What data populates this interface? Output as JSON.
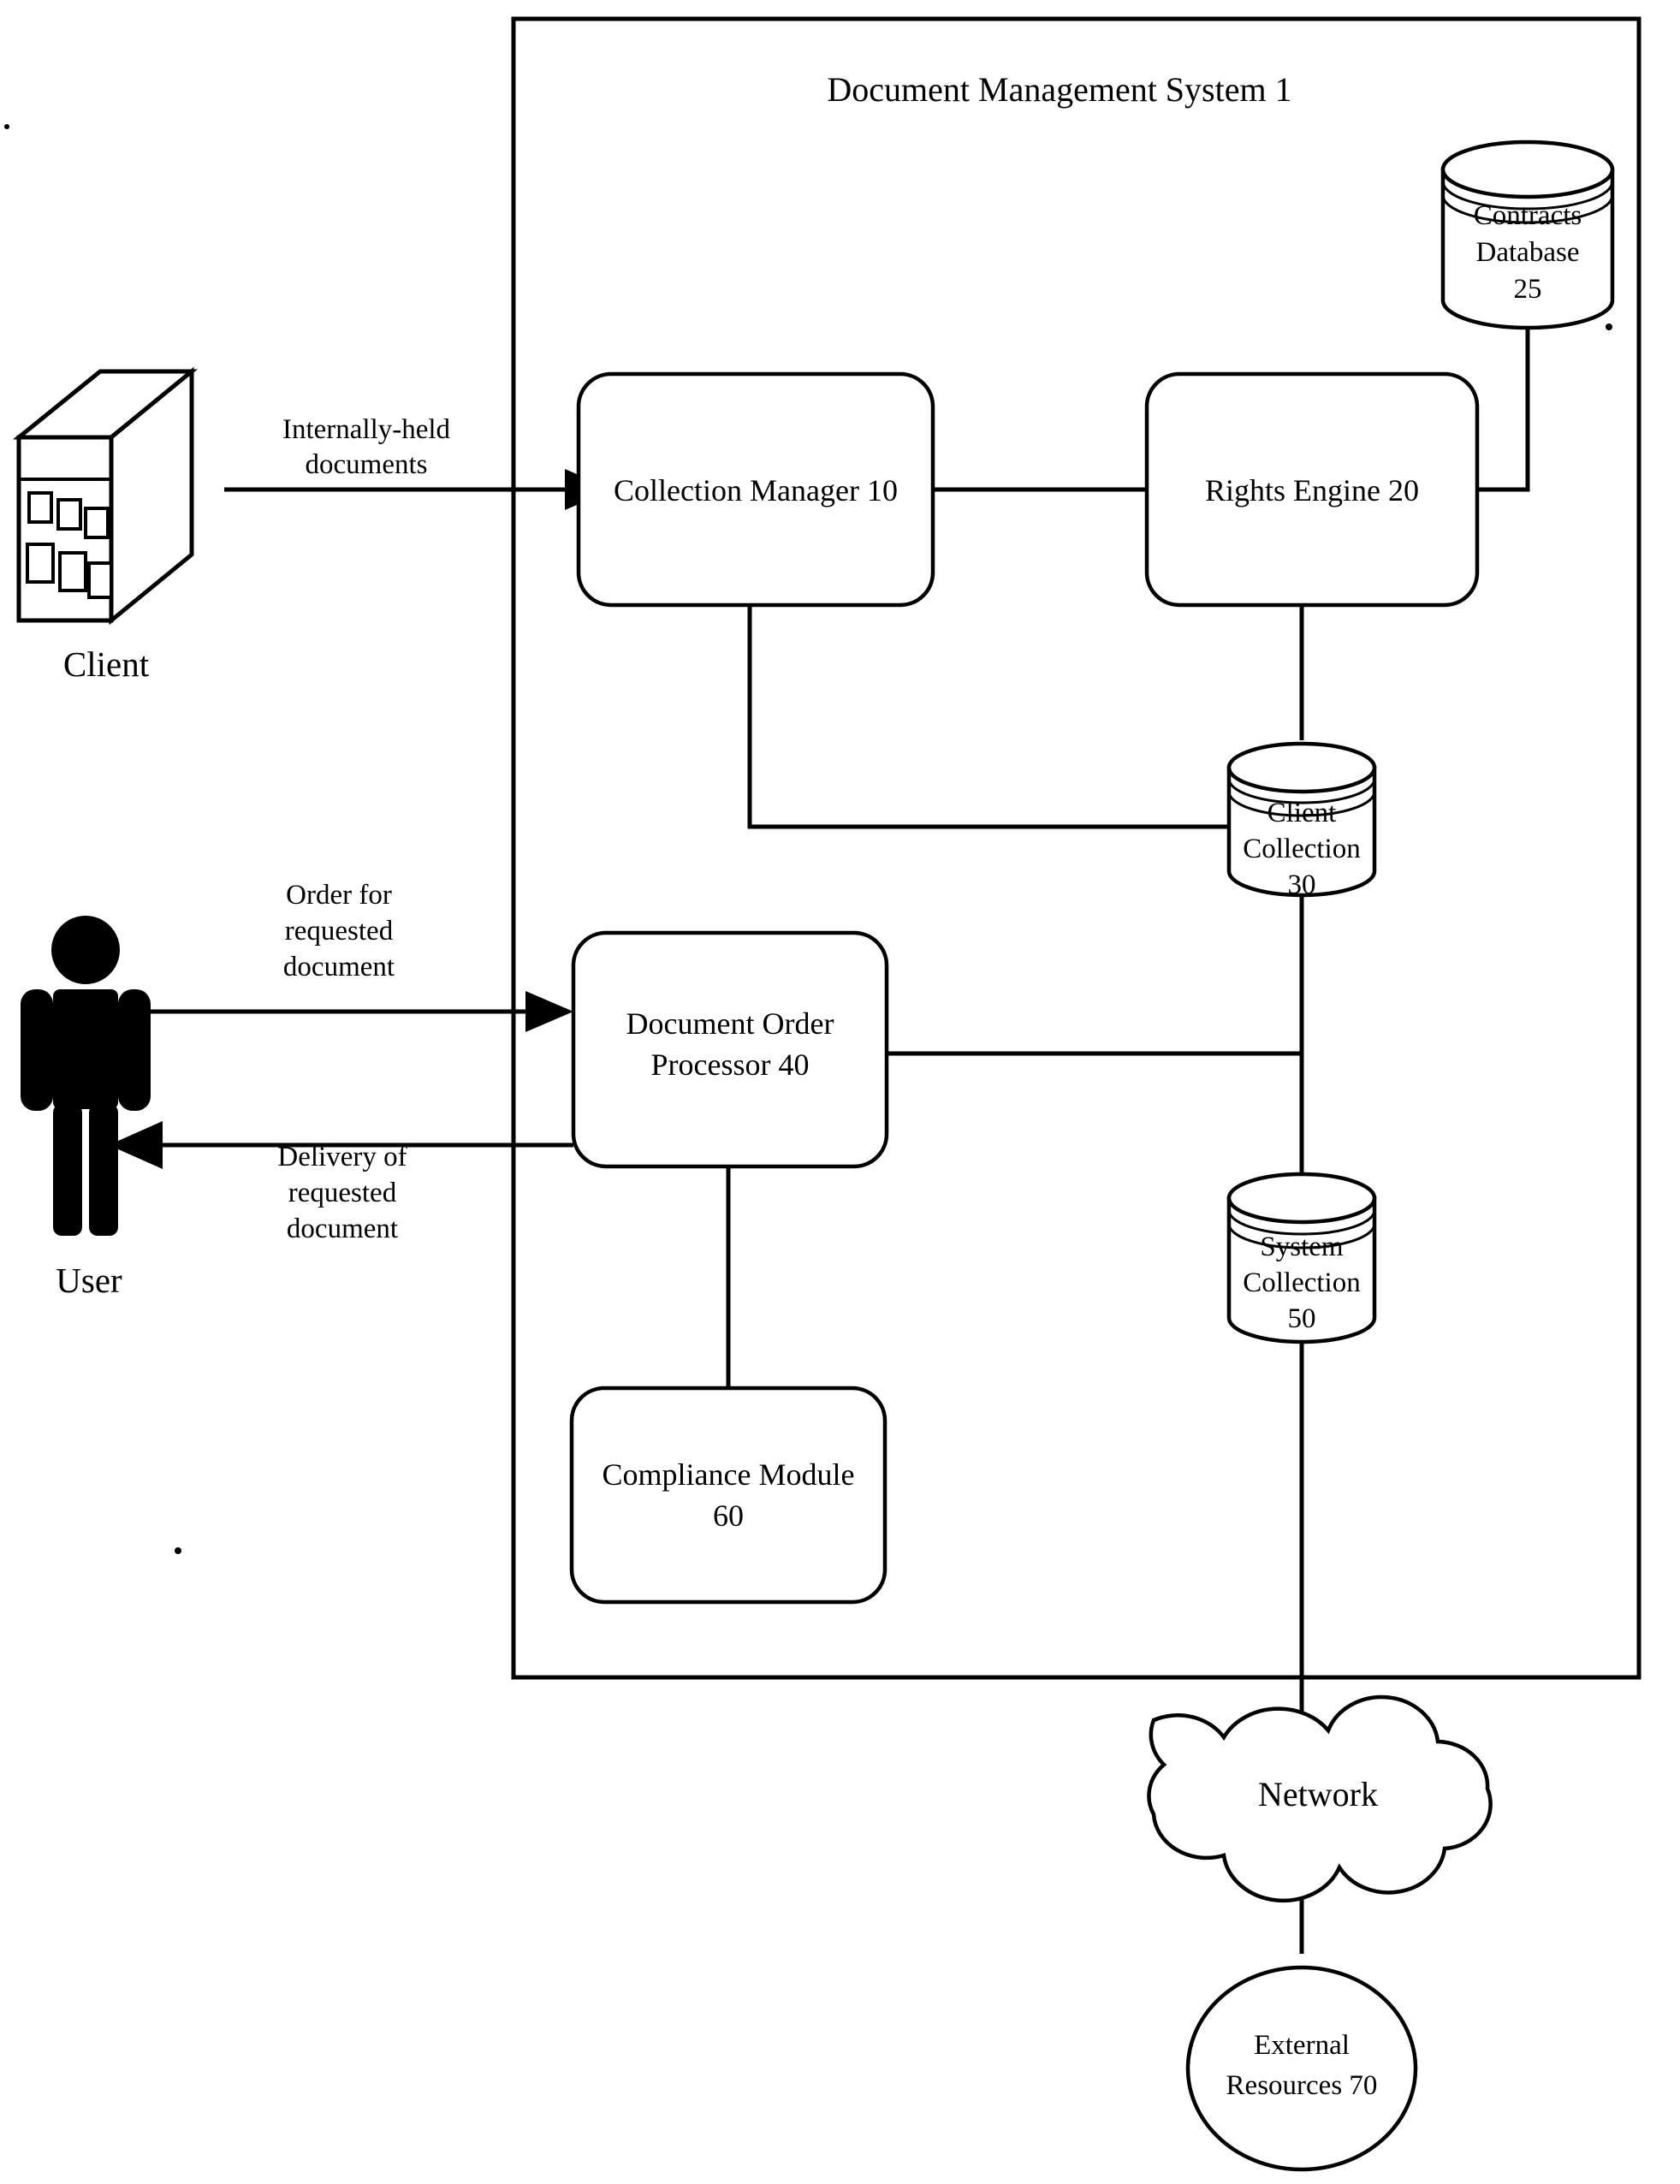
{
  "figure": {
    "title": "Document Management System 1",
    "boundary_label": "Document Management System 1"
  },
  "actors": [
    {
      "id": "client",
      "label": "Client",
      "icon": "building-icon"
    },
    {
      "id": "user",
      "label": "User",
      "icon": "person-icon"
    }
  ],
  "nodes": {
    "collection_manager": {
      "label": "Collection Manager 10",
      "shape": "rounded-rect"
    },
    "rights_engine": {
      "label": "Rights Engine 20",
      "shape": "rounded-rect"
    },
    "document_order_processor": {
      "line1": "Document Order",
      "line2": "Processor 40",
      "shape": "rounded-rect"
    },
    "compliance_module": {
      "line1": "Compliance Module",
      "line2": "60",
      "shape": "rounded-rect"
    }
  },
  "datastores": {
    "contracts_database": {
      "line1": "Contracts",
      "line2": "Database",
      "line3": "25",
      "shape": "cylinder"
    },
    "client_collection": {
      "line1": "Client",
      "line2": "Collection",
      "line3": "30",
      "shape": "cylinder"
    },
    "system_collection": {
      "line1": "System",
      "line2": "Collection",
      "line3": "50",
      "shape": "cylinder"
    }
  },
  "external": {
    "network": {
      "label": "Network",
      "shape": "cloud"
    },
    "external_resources": {
      "line1": "External",
      "line2": "Resources 70",
      "shape": "ellipse"
    }
  },
  "edge_labels": {
    "internally_held": {
      "line1": "Internally-held",
      "line2": "documents"
    },
    "order_for": {
      "line1": "Order for",
      "line2": "requested",
      "line3": "document"
    },
    "delivery_of": {
      "line1": "Delivery of",
      "line2": "requested",
      "line3": "document"
    }
  },
  "colors": {
    "ink": "#000000",
    "paper": "#ffffff"
  }
}
